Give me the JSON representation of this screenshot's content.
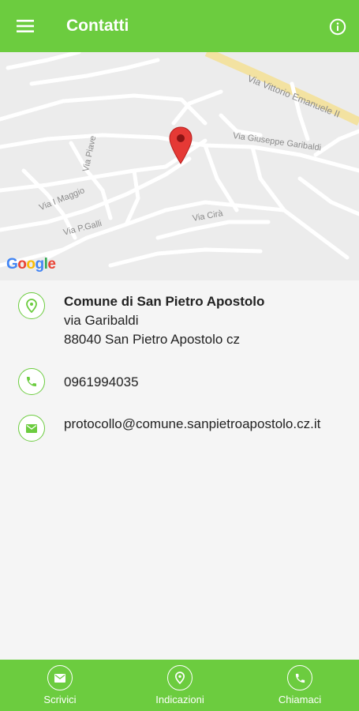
{
  "appbar": {
    "title": "Contatti",
    "menu_icon": "hamburger-menu-icon",
    "info_icon": "info-icon"
  },
  "map": {
    "streets": [
      "Via Vittorio Emanuele II",
      "Via Giuseppe Garibaldi",
      "Via Piave",
      "Via I Maggio",
      "Via P.Galli",
      "Via Cirà"
    ],
    "attribution": "Google",
    "marker_icon": "map-pin-icon"
  },
  "contact": {
    "name": "Comune di San Pietro Apostolo",
    "address_line1": "via Garibaldi",
    "address_line2": "88040 San Pietro Apostolo cz",
    "phone": "0961994035",
    "email": "protocollo@comune.sanpietroapostolo.cz.it"
  },
  "bottom_nav": [
    {
      "label": "Scrivici",
      "icon": "mail-icon"
    },
    {
      "label": "Indicazioni",
      "icon": "location-pin-icon"
    },
    {
      "label": "Chiamaci",
      "icon": "phone-icon"
    }
  ],
  "colors": {
    "brand_green": "#6ccc3f",
    "marker_red": "#e53935",
    "background": "#f5f5f5"
  }
}
